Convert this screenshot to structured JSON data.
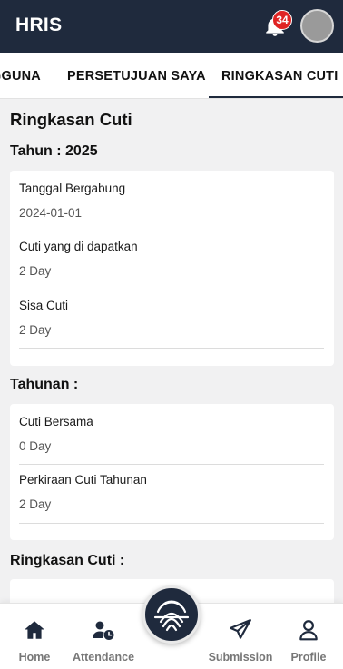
{
  "app": {
    "title": "HRIS",
    "notification_count": "34"
  },
  "tabs": [
    {
      "label": "GGUNA",
      "active": false
    },
    {
      "label": "PERSETUJUAN SAYA",
      "active": false
    },
    {
      "label": "RINGKASAN CUTI",
      "active": true
    }
  ],
  "page": {
    "title": "Ringkasan Cuti",
    "year_heading": "Tahun : 2025",
    "year_card": [
      {
        "label": "Tanggal Bergabung",
        "value": "2024-01-01"
      },
      {
        "label": "Cuti yang di dapatkan",
        "value": "2 Day"
      },
      {
        "label": "Sisa Cuti",
        "value": "2 Day"
      }
    ],
    "annual_heading": "Tahunan :",
    "annual_card": [
      {
        "label": "Cuti Bersama",
        "value": "0 Day"
      },
      {
        "label": "Perkiraan Cuti Tahunan",
        "value": "2 Day"
      }
    ],
    "summary_heading": "Ringkasan Cuti :"
  },
  "bottom_nav": [
    {
      "label": "Home",
      "icon": "home-icon",
      "active": false
    },
    {
      "label": "Attendance",
      "icon": "user-clock-icon",
      "active": false
    },
    {
      "label": "Submission",
      "icon": "paper-plane-icon",
      "active": false
    },
    {
      "label": "Profile",
      "icon": "user-icon",
      "active": true
    }
  ],
  "fab": {
    "icon": "fingerprint-icon"
  },
  "colors": {
    "primary_dark": "#1f2a3d",
    "accent": "#1f6fd6",
    "badge": "#e02424"
  }
}
